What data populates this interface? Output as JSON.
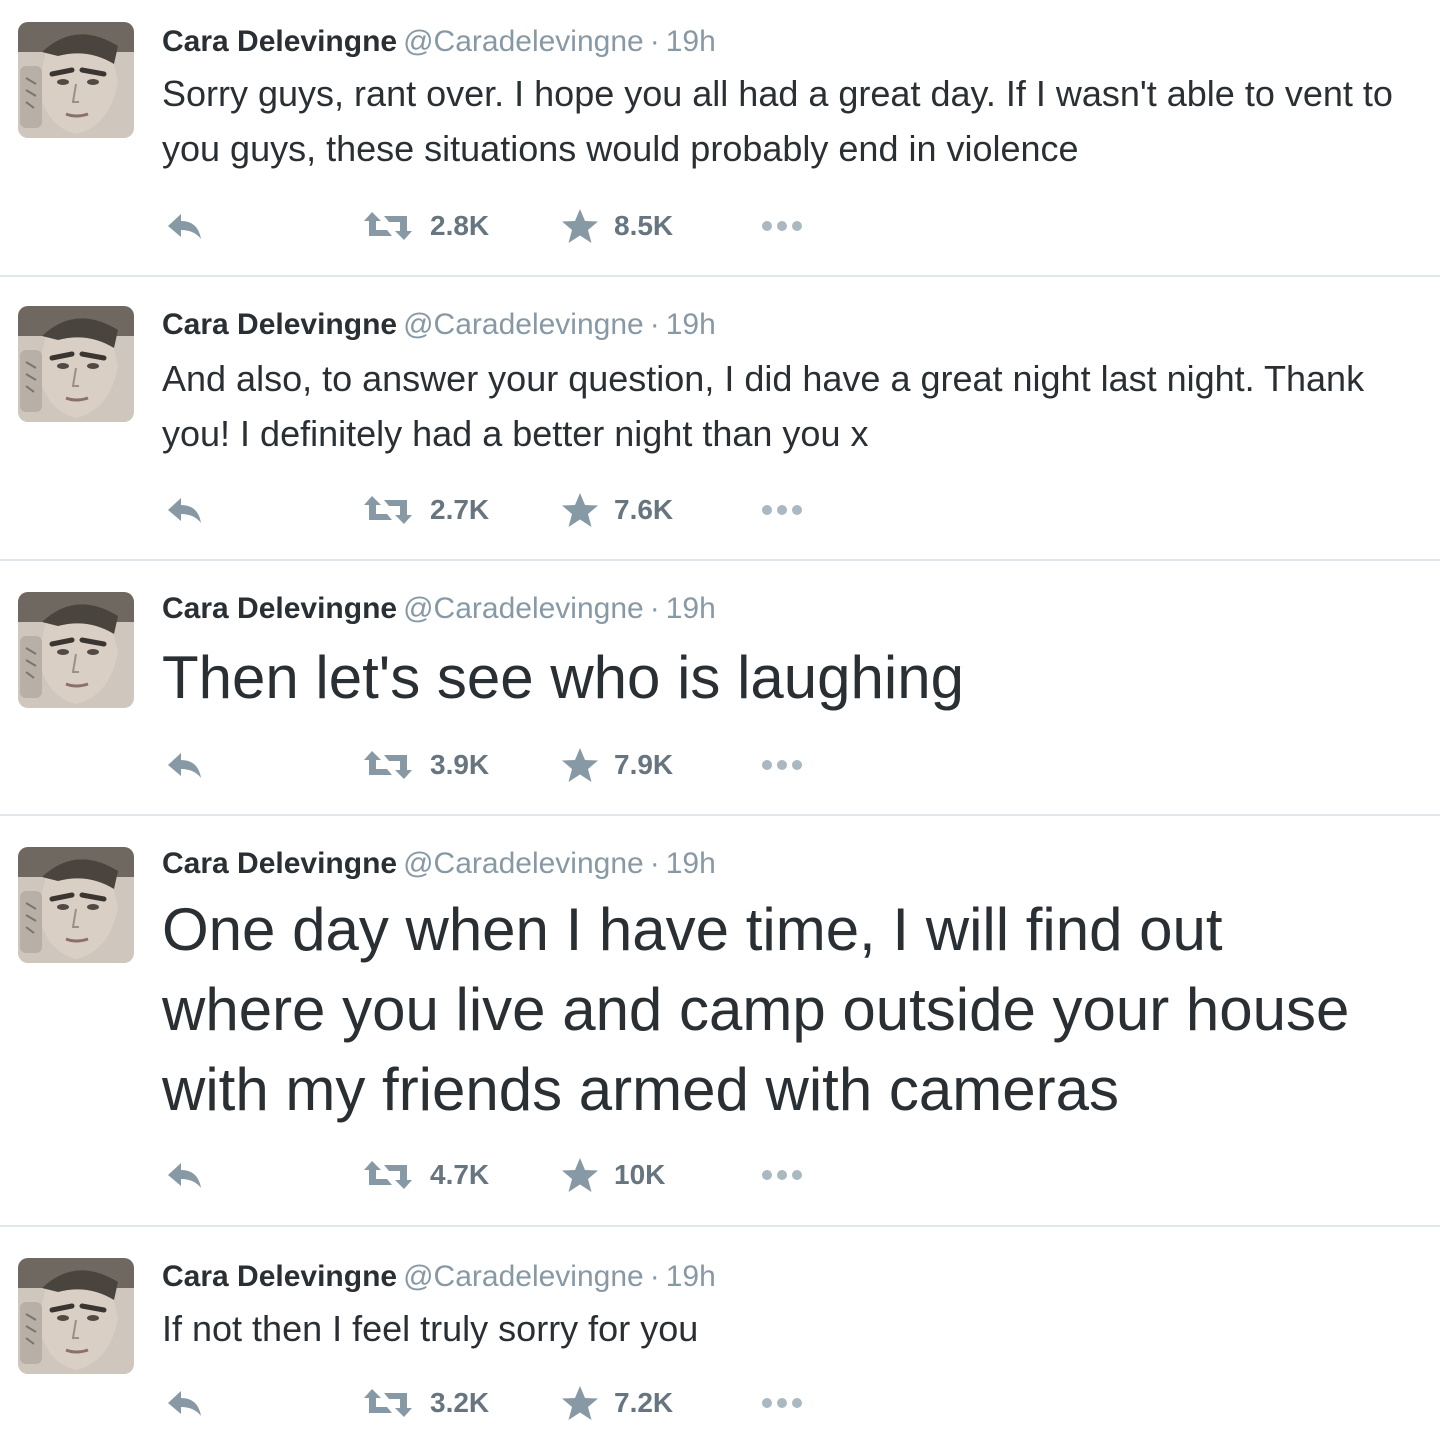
{
  "tweets": [
    {
      "name": "Cara Delevingne",
      "handle": "@Caradelevingne",
      "separator": "·",
      "time": "19h",
      "text": "Sorry guys, rant over. I hope you all had a great day. If I wasn't able to vent to you guys, these situations would probably end in violence",
      "retweets": "2.8K",
      "favorites": "8.5K"
    },
    {
      "name": "Cara Delevingne",
      "handle": "@Caradelevingne",
      "separator": "·",
      "time": "19h",
      "text": "And also, to answer your question, I did have a great night last night. Thank you! I definitely had a better night than you x",
      "retweets": "2.7K",
      "favorites": "7.6K"
    },
    {
      "name": "Cara Delevingne",
      "handle": "@Caradelevingne",
      "separator": "·",
      "time": "19h",
      "text": "Then let's see who is laughing",
      "retweets": "3.9K",
      "favorites": "7.9K"
    },
    {
      "name": "Cara Delevingne",
      "handle": "@Caradelevingne",
      "separator": "·",
      "time": "19h",
      "text": "One day when I have time, I will find out where you live and camp outside your house with my friends armed with cameras",
      "retweets": "4.7K",
      "favorites": "10K"
    },
    {
      "name": "Cara Delevingne",
      "handle": "@Caradelevingne",
      "separator": "·",
      "time": "19h",
      "text": "If not then I feel truly sorry for you",
      "retweets": "3.2K",
      "favorites": "7.2K"
    }
  ],
  "icons": {
    "reply": "reply-icon",
    "retweet": "retweet-icon",
    "favorite": "star-icon",
    "more": "more-icon"
  },
  "colors": {
    "text": "#292f33",
    "muted": "#8899a6",
    "divider": "#e1e8ed"
  }
}
